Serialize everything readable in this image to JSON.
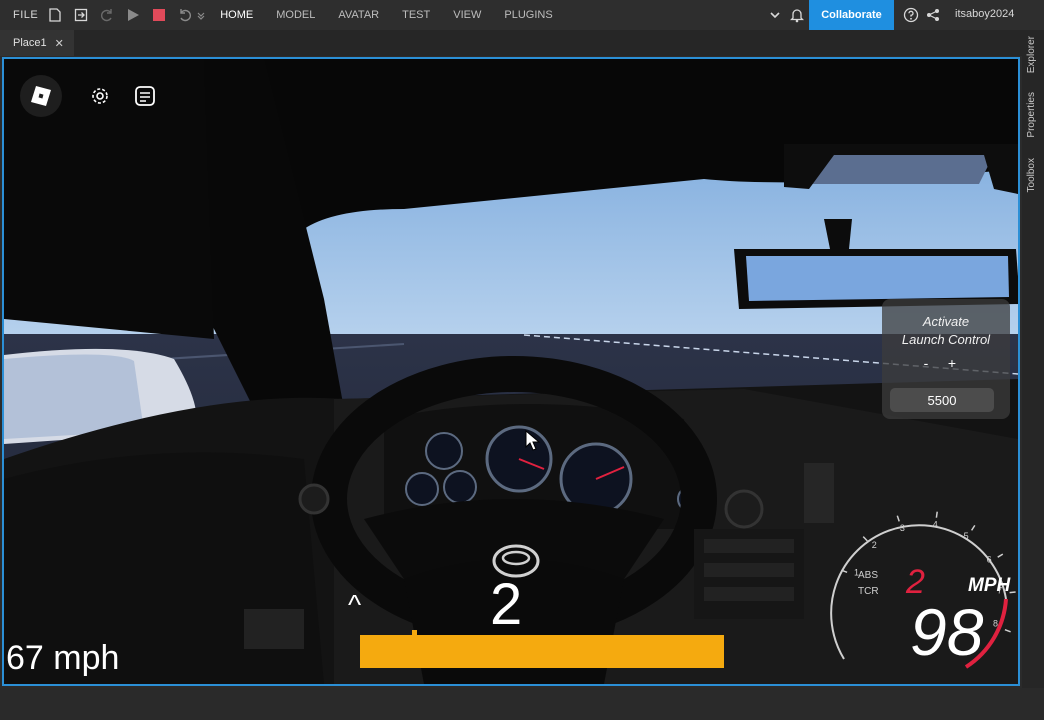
{
  "menubar": {
    "file": "FILE",
    "menus": [
      "HOME",
      "MODEL",
      "AVATAR",
      "TEST",
      "VIEW",
      "PLUGINS"
    ],
    "active_menu": "HOME",
    "collaborate": "Collaborate",
    "username": "itsaboy2024"
  },
  "tabs": [
    {
      "label": "Place1",
      "close": "✕"
    }
  ],
  "right_dock": {
    "tabs": [
      "Explorer",
      "Properties",
      "Toolbox"
    ]
  },
  "game_hud": {
    "launch_control": {
      "title_line1": "Activate",
      "title_line2": "Launch Control",
      "minus": "-",
      "plus": "+",
      "rpm_value": "5500"
    },
    "speed_text": "67 mph",
    "gear": "2",
    "shift_indicator": "^",
    "throttle_fraction": 1.0,
    "gauge": {
      "ticks": [
        "1",
        "2",
        "3",
        "4",
        "5",
        "6",
        "7",
        "8"
      ],
      "abs": "ABS",
      "tcr": "TCR",
      "gear": "2",
      "unit": "MPH",
      "speed": "98"
    }
  },
  "colors": {
    "accent": "#1f8fe0",
    "throttle_bar": "#f5aa0f",
    "gear_red": "#e0213f",
    "viewport_border": "#2b8fd6"
  }
}
